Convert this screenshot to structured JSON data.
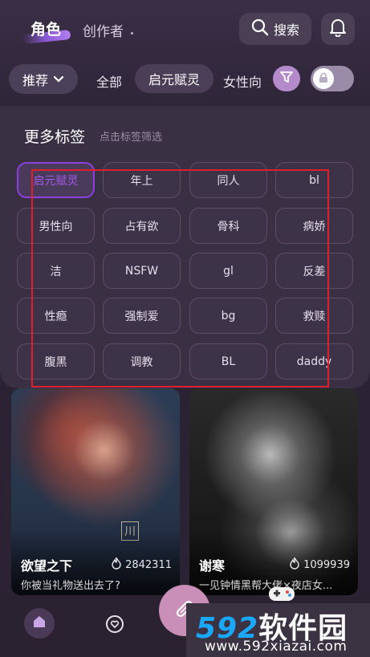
{
  "header": {
    "tab_active": "角色",
    "tab_creator": "创作者",
    "search_label": "搜索",
    "accent_color": "#8d5ad6"
  },
  "filters": {
    "recommend_label": "推荐",
    "tabs": [
      "全部",
      "启元赋灵",
      "女性向"
    ],
    "selected_tab": "启元赋灵",
    "icons": {
      "funnel": "filter-icon",
      "toggle": "lock-icon"
    }
  },
  "panel": {
    "title": "更多标签",
    "hint": "点击标签筛选",
    "tags": [
      "启元赋灵",
      "年上",
      "同人",
      "bl",
      "男性向",
      "占有欲",
      "骨科",
      "病娇",
      "洁",
      "NSFW",
      "gl",
      "反差",
      "性瘾",
      "强制爱",
      "bg",
      "救赎",
      "腹黑",
      "调教",
      "BL",
      "daddy"
    ],
    "selected_tag": "启元赋灵",
    "selected_color": "#8e3fe0"
  },
  "cards": [
    {
      "name": "欲望之下",
      "hot": "2842311",
      "desc": "你被当礼物送出去了?",
      "stamp": "川"
    },
    {
      "name": "谢寒",
      "hot": "1099939",
      "desc": "一见钟情黑帮大佬×夜店女..."
    }
  ],
  "bottom_nav": {
    "icons": [
      "home-icon",
      "chat-heart-icon",
      "create-fab-icon",
      "gamepad-icon"
    ]
  },
  "watermark": {
    "logo_number": "592",
    "logo_text": "软件园",
    "url": "www.592xiazai.com"
  }
}
